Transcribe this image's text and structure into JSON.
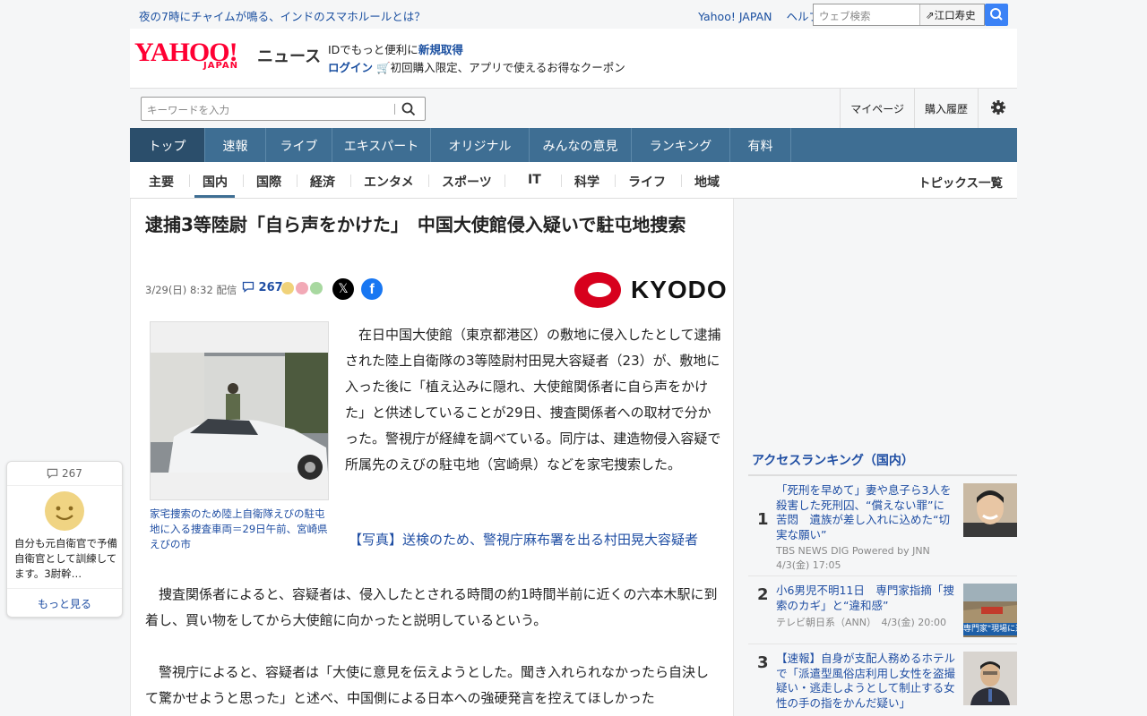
{
  "topbar": {
    "ticker": "夜の7時にチャイムが鳴る、インドのスマホルールとは？",
    "links": [
      "Yahoo! JAPAN",
      "ヘルプ"
    ],
    "search_placeholder": "ウェブ検索",
    "user_name": "江口寿史"
  },
  "header": {
    "logo": "YAHOO!",
    "logo_sub": "JAPAN",
    "service": "ニュース",
    "promo_line1_prefix": "IDでもっと便利に",
    "promo_line1_link": "新規取得",
    "promo_login": "ログイン",
    "promo_line2": "初回購入限定、アプリで使えるお得なクーポン"
  },
  "toolbar": {
    "keyword_placeholder": "キーワードを入力",
    "links": [
      "マイページ",
      "購入履歴"
    ]
  },
  "main_nav": [
    "トップ",
    "速報",
    "ライブ",
    "エキスパート",
    "オリジナル",
    "みんなの意見",
    "ランキング",
    "有料"
  ],
  "sub_nav": {
    "items": [
      "主要",
      "国内",
      "国際",
      "経済",
      "エンタメ",
      "スポーツ",
      "IT",
      "科学",
      "ライフ",
      "地域"
    ],
    "active": "国内",
    "topics": "トピックス一覧"
  },
  "article": {
    "title": "逮捕3等陸尉「自ら声をかけた」　中国大使館侵入疑いで駐屯地捜索",
    "date": "3/29(日) 8:32",
    "delivery": "配信",
    "comment_count": "267",
    "source": "KYODO",
    "photo_caption": "家宅捜索のため陸上自衛隊えびの駐屯地に入る捜査車両＝29日午前、宮崎県えびの市",
    "lead": "在日中国大使館（東京都港区）の敷地に侵入したとして逮捕された陸上自衛隊の3等陸尉村田晃大容疑者（23）が、敷地に入った後に「植え込みに隠れ、大使館関係者に自ら声をかけた」と供述していることが29日、捜査関係者への取材で分かった。警視庁が経緯を調べている。同庁は、建造物侵入容疑で所属先のえびの駐屯地（宮崎県）などを家宅捜索した。",
    "photo_link": "【写真】送検のため、警視庁麻布署を出る村田晃大容疑者",
    "para2": "捜査関係者によると、容疑者は、侵入したとされる時間の約1時間半前に近くの六本木駅に到着し、買い物をしてから大使館に向かったと説明しているという。",
    "para3": "警視庁によると、容疑者は「大使に意見を伝えようとした。聞き入れられなかったら自決して驚かせようと思った」と述べ、中国側による日本への強硬発言を控えてほしかった"
  },
  "ranking": {
    "title": "アクセスランキング（国内）",
    "items": [
      {
        "rank": "1",
        "title": "「死刑を早めて」妻や息子ら3人を殺害した死刑囚、“償えない罪”に苦悶　遺族が差し入れに込めた“切実な願い”",
        "source": "TBS NEWS DIG Powered by JNN",
        "time": "4/3(金) 17:05"
      },
      {
        "rank": "2",
        "title": "小6男児不明11日　専門家指摘「捜索のカギ」と“違和感”",
        "source": "テレビ朝日系（ANN）",
        "time": "4/3(金) 20:00",
        "thumb_text": "専門家\"現場に違"
      },
      {
        "rank": "3",
        "title": "【速報】自身が支配人務めるホテルで「派遣型風俗店利用し女性を盗撮疑い・逃走しようとして制止する女性の手の指をかんだ疑い」",
        "source": "",
        "time": ""
      }
    ]
  },
  "float_comment": {
    "count": "267",
    "text": "自分も元自衛官で予備自衛官として訓練してます。3尉幹…",
    "more": "もっと見る"
  },
  "colors": {
    "nav_bg": "#3e6e93",
    "nav_active": "#2b4e6b",
    "link": "#1f4ea3",
    "logo_red": "#ff0033",
    "kyodo_red": "#d7001d"
  }
}
